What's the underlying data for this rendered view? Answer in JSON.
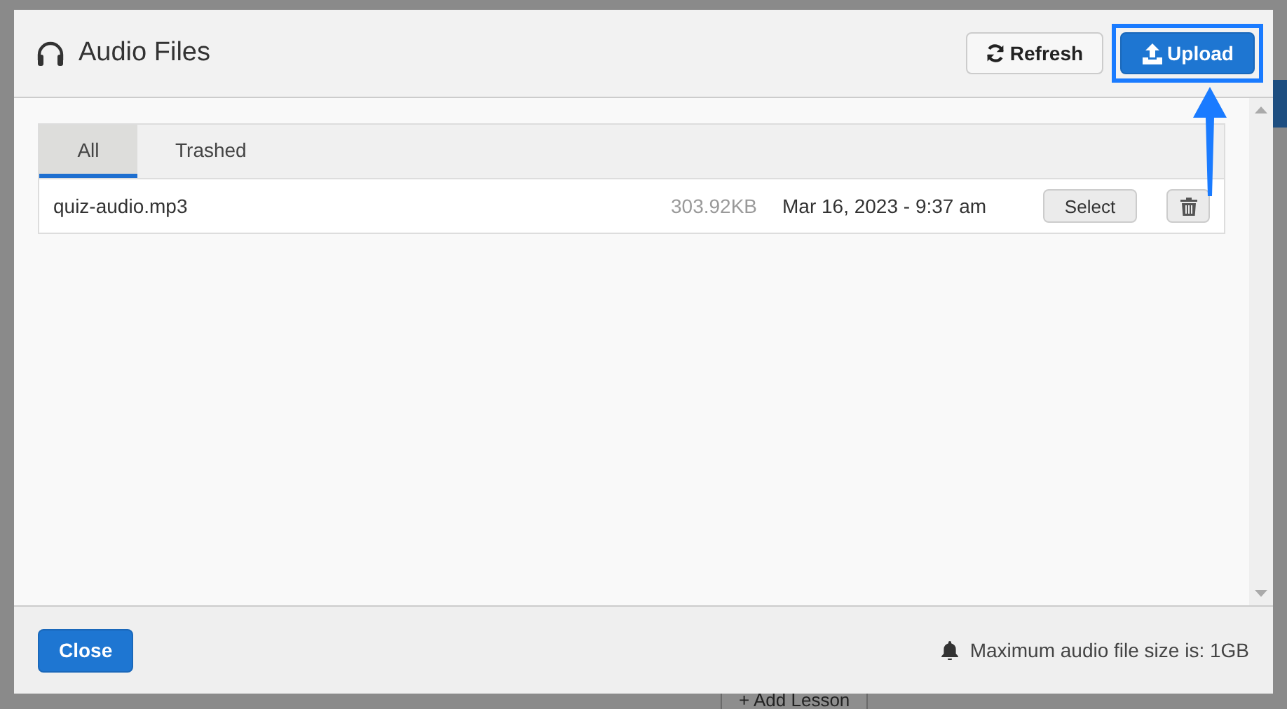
{
  "dialog": {
    "title": "Audio Files",
    "buttons": [
      {
        "label": "Refresh",
        "kind": "refresh",
        "highlighted": false
      },
      {
        "label": "Upload",
        "kind": "upload",
        "highlighted": true
      }
    ]
  },
  "tabs": [
    {
      "label": "All",
      "selected": true
    },
    {
      "label": "Trashed",
      "selected": false
    }
  ],
  "files": [
    {
      "name": "quiz-audio.mp3",
      "size": "303.92KB",
      "date": "Mar 16, 2023 - 9:37 am",
      "action": "Select"
    }
  ],
  "footer": {
    "close": "Close",
    "note": "Maximum audio file size is: 1GB"
  },
  "background": {
    "button": "+ Add Lesson"
  }
}
